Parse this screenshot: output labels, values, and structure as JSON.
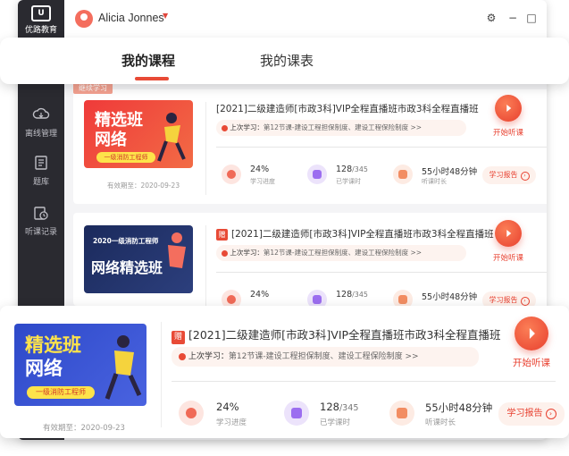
{
  "app": {
    "logo_text": "优路教育",
    "user_name": "Alicia Jonnes"
  },
  "tabs": [
    {
      "label": "我的课程",
      "active": true
    },
    {
      "label": "我的课表",
      "active": false
    }
  ],
  "sidebar": {
    "items": [
      {
        "label": "离线管理",
        "icon": "cloud-icon"
      },
      {
        "label": "题库",
        "icon": "book-icon"
      },
      {
        "label": "听课记录",
        "icon": "clock-record-icon"
      }
    ]
  },
  "colors": {
    "accent": "#e84a36",
    "sidebar_bg": "#2a2a30"
  },
  "courses": [
    {
      "tag": "继续学习",
      "cover_big_1": "精选班",
      "cover_big_2": "网络",
      "cover_chip": "一级消防工程师",
      "valid_until": "有效期至：2020-09-23",
      "zeng": "",
      "title": "[2021]二级建造师[市政3科]VIP全程直播班市政3科全程直播班",
      "last_study_label": "上次学习：",
      "last_study_text": "第12节课-建设工程担保制度、建设工程保险制度 >>",
      "play_label": "开始听课",
      "progress_value": "24%",
      "progress_label": "学习进度",
      "lessons_done": "128",
      "lessons_total": "/345",
      "lessons_label": "已学课时",
      "hours_value": "55小时48分钟",
      "hours_label": "听课时长",
      "report_label": "学习报告"
    },
    {
      "tag": "",
      "cover_top": "2020一级消防工程师",
      "cover_big_1": "网络精选班",
      "valid_until": "有效期至：2020-09-23",
      "zeng": "赠",
      "title": "[2021]二级建造师[市政3科]VIP全程直播班市政3科全程直播班",
      "last_study_label": "上次学习：",
      "last_study_text": "第12节课-建设工程担保制度、建设工程保险制度 >>",
      "play_label": "开始听课",
      "progress_value": "24%",
      "progress_label": "学习进度",
      "lessons_done": "128",
      "lessons_total": "/345",
      "lessons_label": "已学课时",
      "hours_value": "55小时48分钟",
      "hours_label": "听课时长",
      "report_label": "学习报告"
    }
  ],
  "featured": {
    "cover_big_1": "精选班",
    "cover_big_2": "网络",
    "cover_chip": "一级消防工程师",
    "valid_until": "有效期至：2020-09-23",
    "zeng": "赠",
    "title": "[2021]二级建造师[市政3科]VIP全程直播班市政3科全程直播班",
    "last_study_label": "上次学习：",
    "last_study_text": "第12节课-建设工程担保制度、建设工程保险制度 >>",
    "play_label": "开始听课",
    "progress_value": "24%",
    "progress_label": "学习进度",
    "lessons_done": "128",
    "lessons_total": "/345",
    "lessons_label": "已学课时",
    "hours_value": "55小时48分钟",
    "hours_label": "听课时长",
    "report_label": "学习报告"
  }
}
